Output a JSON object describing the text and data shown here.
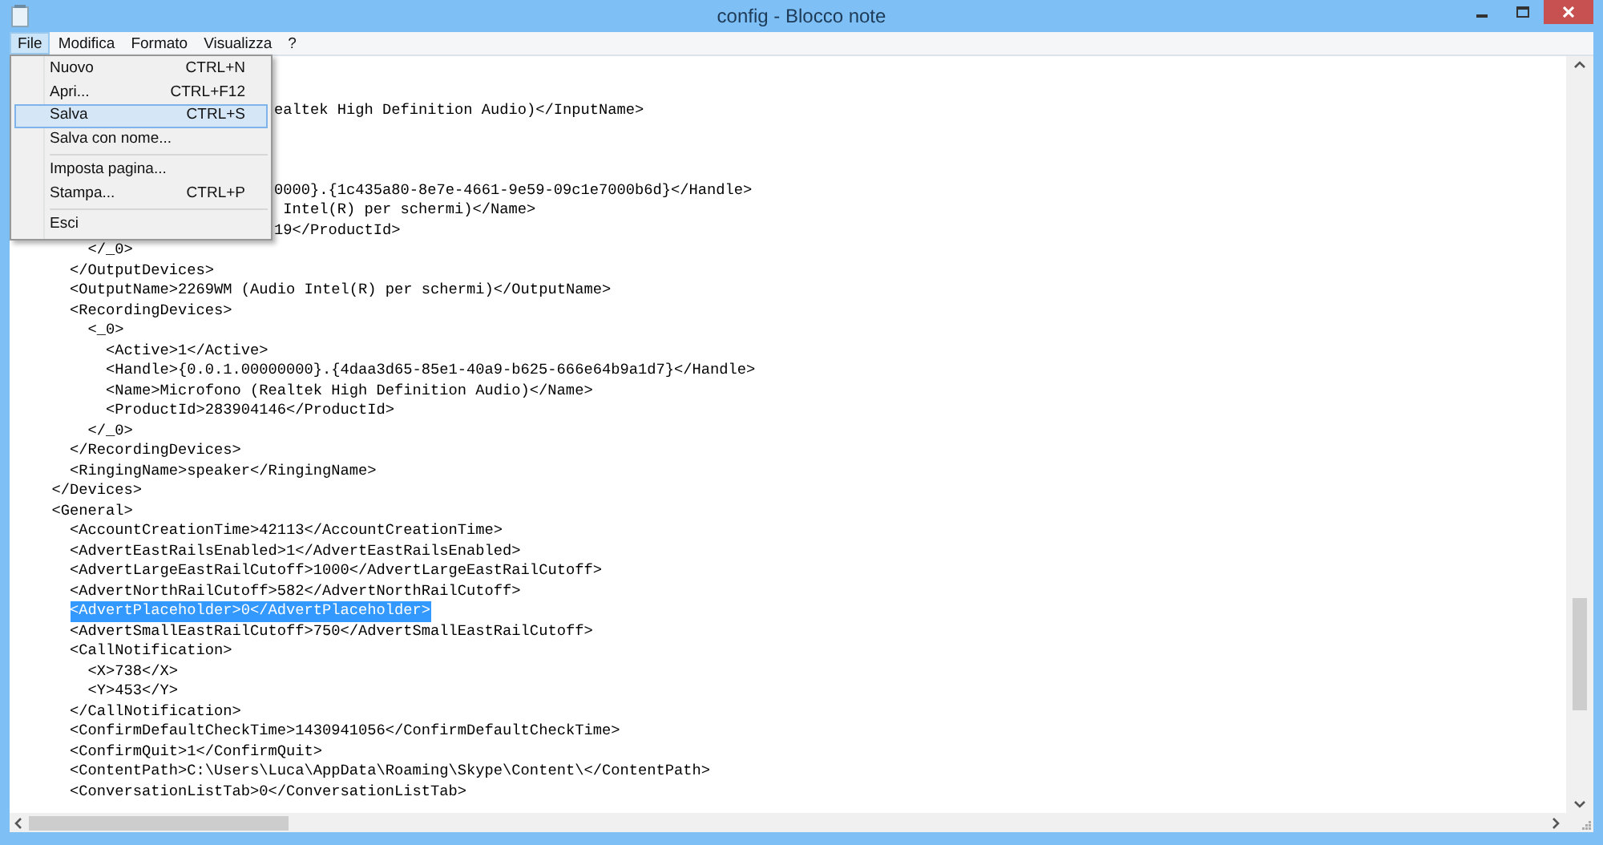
{
  "window": {
    "title": "config - Blocco note"
  },
  "menu_bar": [
    {
      "label": "File",
      "selected": true
    },
    {
      "label": "Modifica",
      "selected": false
    },
    {
      "label": "Formato",
      "selected": false
    },
    {
      "label": "Visualizza",
      "selected": false
    },
    {
      "label": "?",
      "selected": false
    }
  ],
  "file_menu": [
    {
      "kind": "item",
      "label": "Nuovo",
      "shortcut": "CTRL+N",
      "selected": false
    },
    {
      "kind": "item",
      "label": "Apri...",
      "shortcut": "CTRL+F12",
      "selected": false
    },
    {
      "kind": "item",
      "label": "Salva",
      "shortcut": "CTRL+S",
      "selected": true
    },
    {
      "kind": "item",
      "label": "Salva con nome...",
      "selected": false
    },
    {
      "kind": "separator"
    },
    {
      "kind": "item",
      "label": "Imposta pagina...",
      "selected": false
    },
    {
      "kind": "item",
      "label": "Stampa...",
      "shortcut": "CTRL+P",
      "selected": false
    },
    {
      "kind": "separator"
    },
    {
      "kind": "item",
      "label": "Esci",
      "selected": false
    }
  ],
  "editor_lines": [
    {
      "kind": "blank"
    },
    {
      "kind": "clipped",
      "text": "ealtek High Definition Audio)</InputName>",
      "selected": false
    },
    {
      "kind": "blank"
    },
    {
      "kind": "blank"
    },
    {
      "kind": "blank"
    },
    {
      "kind": "clipped",
      "text": "0000}.{1c435a80-8e7e-4661-9e59-09c1e7000b6d}</Handle>",
      "selected": false
    },
    {
      "kind": "clipped",
      "text": " Intel(R) per schermi)</Name>",
      "selected": false
    },
    {
      "kind": "clipped",
      "text": "19</ProductId>",
      "selected": false
    },
    {
      "kind": "full",
      "text": "      </_0>",
      "selected": false
    },
    {
      "kind": "full",
      "text": "    </OutputDevices>",
      "selected": false
    },
    {
      "kind": "full",
      "text": "    <OutputName>2269WM (Audio Intel(R) per schermi)</OutputName>",
      "selected": false
    },
    {
      "kind": "full",
      "text": "    <RecordingDevices>",
      "selected": false
    },
    {
      "kind": "full",
      "text": "      <_0>",
      "selected": false
    },
    {
      "kind": "full",
      "text": "        <Active>1</Active>",
      "selected": false
    },
    {
      "kind": "full",
      "text": "        <Handle>{0.0.1.00000000}.{4daa3d65-85e1-40a9-b625-666e64b9a1d7}</Handle>",
      "selected": false
    },
    {
      "kind": "full",
      "text": "        <Name>Microfono (Realtek High Definition Audio)</Name>",
      "selected": false
    },
    {
      "kind": "full",
      "text": "        <ProductId>283904146</ProductId>",
      "selected": false
    },
    {
      "kind": "full",
      "text": "      </_0>",
      "selected": false
    },
    {
      "kind": "full",
      "text": "    </RecordingDevices>",
      "selected": false
    },
    {
      "kind": "full",
      "text": "    <RingingName>speaker</RingingName>",
      "selected": false
    },
    {
      "kind": "full",
      "text": "  </Devices>",
      "selected": false
    },
    {
      "kind": "full",
      "text": "  <General>",
      "selected": false
    },
    {
      "kind": "full",
      "text": "    <AccountCreationTime>42113</AccountCreationTime>",
      "selected": false
    },
    {
      "kind": "full",
      "text": "    <AdvertEastRailsEnabled>1</AdvertEastRailsEnabled>",
      "selected": false
    },
    {
      "kind": "full",
      "text": "    <AdvertLargeEastRailCutoff>1000</AdvertLargeEastRailCutoff>",
      "selected": false
    },
    {
      "kind": "full",
      "text": "    <AdvertNorthRailCutoff>582</AdvertNorthRailCutoff>",
      "selected": false
    },
    {
      "kind": "full",
      "text": "    <AdvertPlaceholder>0</AdvertPlaceholder>",
      "selected": true
    },
    {
      "kind": "full",
      "text": "    <AdvertSmallEastRailCutoff>750</AdvertSmallEastRailCutoff>",
      "selected": false
    },
    {
      "kind": "full",
      "text": "    <CallNotification>",
      "selected": false
    },
    {
      "kind": "full",
      "text": "      <X>738</X>",
      "selected": false
    },
    {
      "kind": "full",
      "text": "      <Y>453</Y>",
      "selected": false
    },
    {
      "kind": "full",
      "text": "    </CallNotification>",
      "selected": false
    },
    {
      "kind": "full",
      "text": "    <ConfirmDefaultCheckTime>1430941056</ConfirmDefaultCheckTime>",
      "selected": false
    },
    {
      "kind": "full",
      "text": "    <ConfirmQuit>1</ConfirmQuit>",
      "selected": false
    },
    {
      "kind": "full",
      "text": "    <ContentPath>C:\\Users\\Luca\\AppData\\Roaming\\Skype\\Content\\</ContentPath>",
      "selected": false
    },
    {
      "kind": "full",
      "text": "    <ConversationListTab>0</ConversationListTab>",
      "selected": false
    }
  ]
}
